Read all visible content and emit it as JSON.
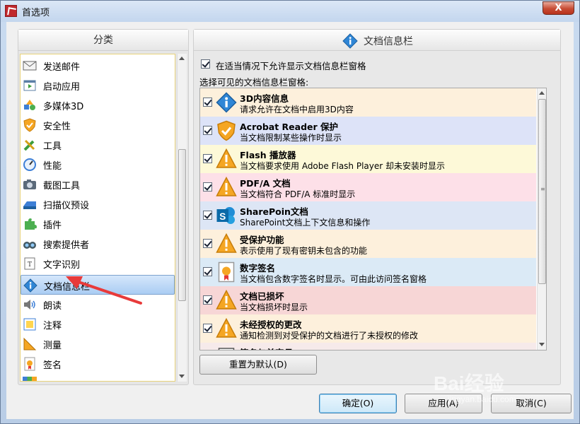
{
  "window": {
    "title": "首选项",
    "close_label": "X"
  },
  "left_panel": {
    "header": "分类",
    "items": [
      {
        "label": "发送邮件",
        "icon": "mail-icon"
      },
      {
        "label": "启动应用",
        "icon": "launch-app-icon"
      },
      {
        "label": "多媒体3D",
        "icon": "multimedia-3d-icon"
      },
      {
        "label": "安全性",
        "icon": "security-shield-icon"
      },
      {
        "label": "工具",
        "icon": "tools-icon"
      },
      {
        "label": "性能",
        "icon": "performance-gauge-icon"
      },
      {
        "label": "截图工具",
        "icon": "camera-icon"
      },
      {
        "label": "扫描仪预设",
        "icon": "scanner-icon"
      },
      {
        "label": "插件",
        "icon": "puzzle-icon"
      },
      {
        "label": "搜索提供者",
        "icon": "binoculars-icon"
      },
      {
        "label": "文字识别",
        "icon": "ocr-icon"
      },
      {
        "label": "文档信息栏",
        "icon": "info-icon",
        "selected": true
      },
      {
        "label": "朗读",
        "icon": "speaker-icon"
      },
      {
        "label": "注释",
        "icon": "comment-icon"
      },
      {
        "label": "测量",
        "icon": "ruler-icon"
      },
      {
        "label": "签名",
        "icon": "signature-icon"
      }
    ]
  },
  "right_panel": {
    "header": "文档信息栏",
    "allow_checkbox": {
      "label": "在适当情况下允许显示文档信息栏窗格",
      "checked": true
    },
    "visible_label": "选择可见的文档信息栏窗格:",
    "bars": [
      {
        "title": "3D内容信息",
        "desc": "请求允许在文档中启用3D内容",
        "icon": "info-icon",
        "bg": "#fdf0dc",
        "checked": true
      },
      {
        "title": "Acrobat Reader 保护",
        "desc": "当文档限制某些操作时显示",
        "icon": "shield-icon",
        "bg": "#dde3f8",
        "checked": true
      },
      {
        "title": "Flash 播放器",
        "desc": "当文档要求使用 Adobe Flash Player 却未安装时显示",
        "icon": "warning-icon",
        "bg": "#fdf9d8",
        "checked": true
      },
      {
        "title": "PDF/A 文档",
        "desc": "当文档符合 PDF/A 标准时显示",
        "icon": "warning-icon",
        "bg": "#fde0e8",
        "checked": true
      },
      {
        "title": "SharePoin文档",
        "desc": "SharePoint文档上下文信息和操作",
        "icon": "sharepoint-icon",
        "bg": "#dde6f5",
        "checked": true
      },
      {
        "title": "受保护功能",
        "desc": "表示使用了现有密钥未包含的功能",
        "icon": "warning-icon",
        "bg": "#fdf0dc",
        "checked": true
      },
      {
        "title": "数字签名",
        "desc": "当文档包含数字签名时显示。可由此访问签名窗格",
        "icon": "certificate-icon",
        "bg": "#dbeaf6",
        "checked": true
      },
      {
        "title": "文档已损坏",
        "desc": "当文档损坏时显示",
        "icon": "warning-icon",
        "bg": "#f7d6d6",
        "checked": true
      },
      {
        "title": "未经授权的更改",
        "desc": "通知检测到对受保护的文档进行了未授权的修改",
        "icon": "warning-icon",
        "bg": "#fdf0dc",
        "checked": true
      },
      {
        "title": "签名与首字母",
        "desc": "",
        "icon": "document-icon",
        "bg": "#f6eaea",
        "checked": true
      }
    ],
    "reset_button": "重置为默认(D)"
  },
  "footer": {
    "ok": "确定(O)",
    "apply": "应用(A)",
    "cancel": "取消(C)"
  },
  "watermark": {
    "text": "Bai经验",
    "sub": "jingyan.baidu.com"
  },
  "colors": {
    "selected_bg": "#aacdf3",
    "accent": "#3c7fb1",
    "annotation_arrow": "#e83a3a"
  }
}
